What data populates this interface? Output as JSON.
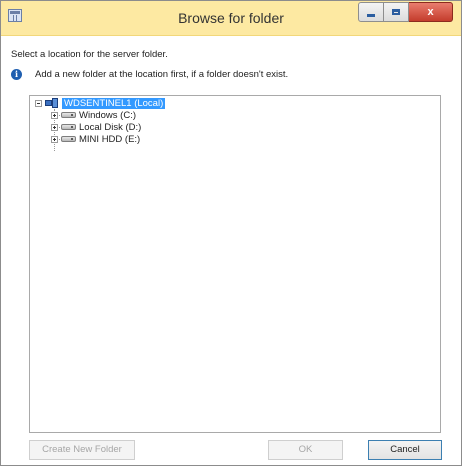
{
  "window": {
    "title": "Browse for folder",
    "titlebar_color": "#fde9a2",
    "controls": {
      "minimize_icon": "minimize-icon",
      "maximize_icon": "maximize-icon",
      "close_label": "x"
    }
  },
  "prompt": "Select a location for the server folder.",
  "info": {
    "icon": "info-icon",
    "text": "Add a new folder at the location first, if a folder doesn't exist."
  },
  "tree": {
    "root": {
      "label": "WDSENTINEL1 (Local)",
      "icon": "network-computer-icon",
      "expanded": true,
      "selected": true
    },
    "children": [
      {
        "label": "Windows  (C:)",
        "icon": "drive-icon",
        "expanded": false
      },
      {
        "label": "Local Disk (D:)",
        "icon": "drive-icon",
        "expanded": false
      },
      {
        "label": "MINI HDD (E:)",
        "icon": "drive-icon",
        "expanded": false
      }
    ],
    "selection_color": "#3399ff"
  },
  "buttons": {
    "create_new_folder": "Create New Folder",
    "ok": "OK",
    "cancel": "Cancel"
  }
}
